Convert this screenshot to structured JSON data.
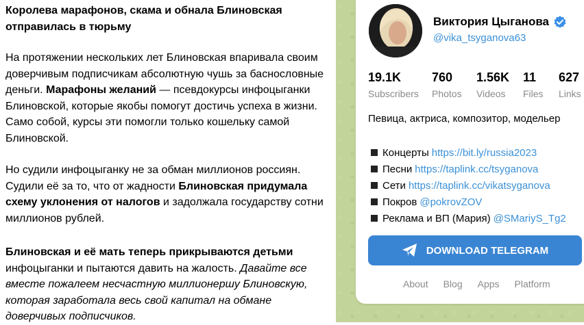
{
  "post": {
    "title": "Королева марафонов, скама и обнала Блиновская отправилась в тюрьму",
    "p1_a": "На протяжении нескольких лет Блиновская впаривала своим доверчивым подписчикам абсолютную чушь за баснословные деньги. ",
    "p1_bold": "Марафоны желаний",
    "p1_b": " — псевдокурсы инфоцыганки Блиновской, которые якобы помогут достичь успеха в жизни. Само собой, курсы эти помогли только кошельку самой Блиновской.",
    "p2_a": "Но судили инфоцыганку не за обман миллионов россиян. Судили её за то, что от жадности ",
    "p2_bold": "Блиновская придумала схему уклонения от налогов",
    "p2_b": " и задолжала государству сотни миллионов рублей.",
    "p3_bold": "Блиновская и её мать теперь прикрываются детьми",
    "p3_a": " инфоцыганки и пытаются давить на жалость. ",
    "p3_italic": "Давайте все вместе пожалеем несчастную миллионершу Блиновскую, которая заработала весь свой капитал на обмане доверчивых подписчиков."
  },
  "channel": {
    "name": "Виктория Цыганова",
    "handle": "@vika_tsyganova63",
    "verified_icon": "verified-badge-icon",
    "avatar_icon": "avatar-photo",
    "stats": [
      {
        "value": "19.1K",
        "label": "Subscribers"
      },
      {
        "value": "760",
        "label": "Photos"
      },
      {
        "value": "1.56K",
        "label": "Videos"
      },
      {
        "value": "11",
        "label": "Files"
      },
      {
        "value": "627",
        "label": "Links"
      }
    ],
    "bio": "Певица, актриса, композитор, модельер",
    "links": [
      {
        "label": "Концерты",
        "url": "https://bit.ly/russia2023"
      },
      {
        "label": "Песни",
        "url": "https://taplink.cc/tsyganova"
      },
      {
        "label": "Сети",
        "url": "https://taplink.cc/vikatsyganova"
      },
      {
        "label": "Покров",
        "url": "@pokrovZOV"
      },
      {
        "label": "Реклама и ВП (Мария)",
        "url": "@SMariyS_Tg2"
      }
    ],
    "download_label": "DOWNLOAD TELEGRAM",
    "footer": [
      "About",
      "Blog",
      "Apps",
      "Platform"
    ]
  },
  "colors": {
    "accent": "#3a85d3",
    "link": "#3b90d6",
    "background": "#c3d49a",
    "muted": "#8a8a8a"
  }
}
